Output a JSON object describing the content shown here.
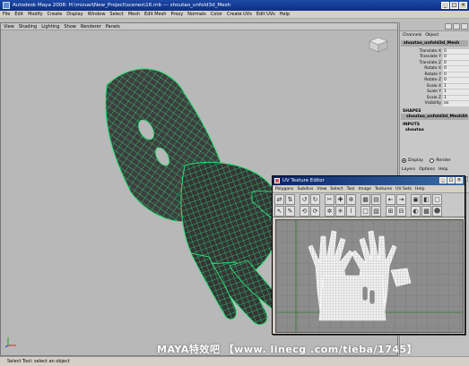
{
  "window": {
    "title": "Autodesk Maya 2008: H:\\mizuei\\New_Project\\scenes\\16.mb   ---   shoutao_unfold3d_Mesh",
    "controls": [
      "_",
      "□",
      "×"
    ]
  },
  "menubar": [
    "File",
    "Edit",
    "Modify",
    "Create",
    "Display",
    "Window",
    "Select",
    "Mesh",
    "Edit Mesh",
    "Proxy",
    "Normals",
    "Color",
    "Create UVs",
    "Edit UVs",
    "Help"
  ],
  "viewport": {
    "menu": [
      "View",
      "Shading",
      "Lighting",
      "Show",
      "Renderer",
      "Panels"
    ]
  },
  "channel_box": {
    "tabs": [
      "Channels",
      "Object"
    ],
    "object_name": "shoutao_unfold3d_Mesh",
    "attributes": [
      {
        "label": "Translate X",
        "value": "0"
      },
      {
        "label": "Translate Y",
        "value": "0"
      },
      {
        "label": "Translate Z",
        "value": "0"
      },
      {
        "label": "Rotate X",
        "value": "0"
      },
      {
        "label": "Rotate Y",
        "value": "0"
      },
      {
        "label": "Rotate Z",
        "value": "0"
      },
      {
        "label": "Scale X",
        "value": "1"
      },
      {
        "label": "Scale Y",
        "value": "1"
      },
      {
        "label": "Scale Z",
        "value": "1"
      },
      {
        "label": "Visibility",
        "value": "on"
      }
    ],
    "shapes_header": "SHAPES",
    "shape_name": "shoutao_unfold3d_MeshSh",
    "inputs_header": "INPUTS",
    "input_name": "shoutao"
  },
  "layers": {
    "options": [
      "Display",
      "Render"
    ],
    "selected": "Display",
    "menu": [
      "Layers",
      "Options",
      "Help"
    ]
  },
  "help_line": "Select Tool: select an object",
  "watermark": "MAYA特效吧  【www. linecg .com/tieba/1745】",
  "uv_editor": {
    "title": "UV Texture Editor",
    "menu": [
      "Polygons",
      "Subdivs",
      "View",
      "Select",
      "Tool",
      "Image",
      "Textures",
      "UV Sets",
      "Help"
    ]
  },
  "colors": {
    "mesh_wire": "#2de07a",
    "mesh_fill": "#3c3c3c",
    "viewport_bg": "#b8b8b8",
    "uv_bg": "#8c8c8c",
    "uv_grid": "#6f6f6f",
    "title_bar": "#0d2f86"
  }
}
